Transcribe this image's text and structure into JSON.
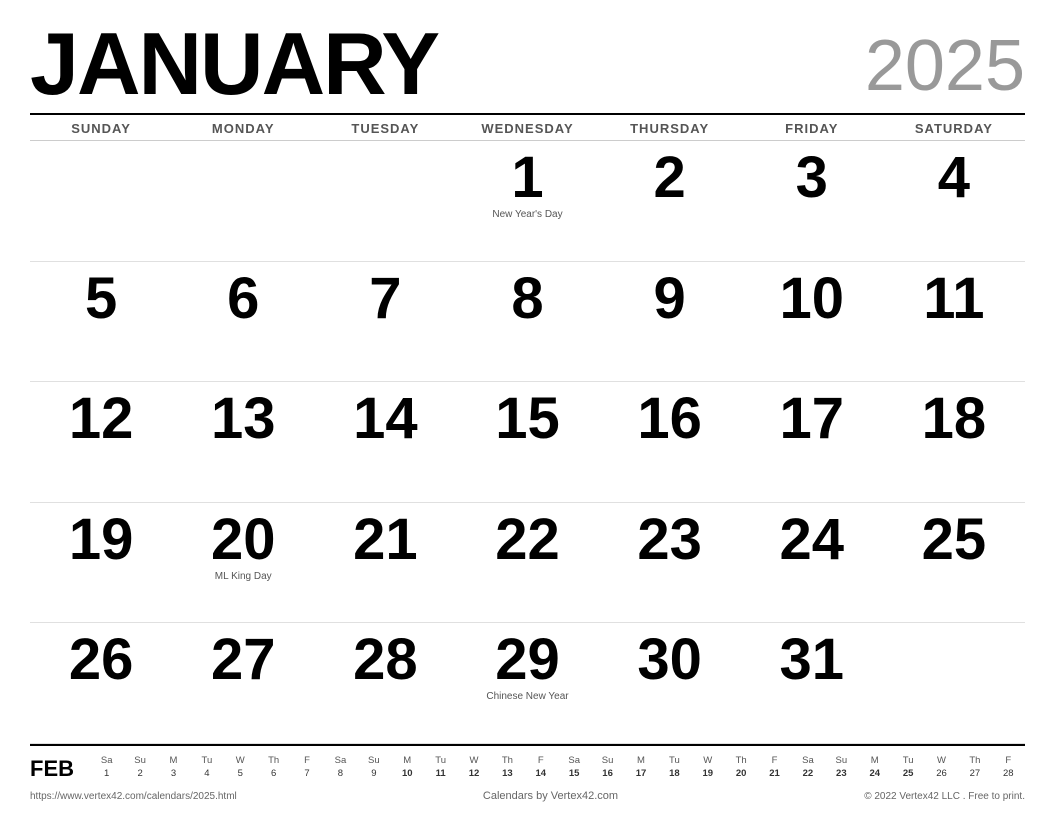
{
  "header": {
    "month": "JANUARY",
    "year": "2025"
  },
  "day_headers": [
    "SUNDAY",
    "MONDAY",
    "TUESDAY",
    "WEDNESDAY",
    "THURSDAY",
    "FRIDAY",
    "SATURDAY"
  ],
  "weeks": [
    {
      "days": [
        {
          "number": "",
          "note": ""
        },
        {
          "number": "",
          "note": ""
        },
        {
          "number": "",
          "note": ""
        },
        {
          "number": "1",
          "note": "New Year's Day"
        },
        {
          "number": "2",
          "note": ""
        },
        {
          "number": "3",
          "note": ""
        },
        {
          "number": "4",
          "note": ""
        }
      ]
    },
    {
      "days": [
        {
          "number": "5",
          "note": ""
        },
        {
          "number": "6",
          "note": ""
        },
        {
          "number": "7",
          "note": ""
        },
        {
          "number": "8",
          "note": ""
        },
        {
          "number": "9",
          "note": ""
        },
        {
          "number": "10",
          "note": ""
        },
        {
          "number": "11",
          "note": ""
        }
      ]
    },
    {
      "days": [
        {
          "number": "12",
          "note": ""
        },
        {
          "number": "13",
          "note": ""
        },
        {
          "number": "14",
          "note": ""
        },
        {
          "number": "15",
          "note": ""
        },
        {
          "number": "16",
          "note": ""
        },
        {
          "number": "17",
          "note": ""
        },
        {
          "number": "18",
          "note": ""
        }
      ]
    },
    {
      "days": [
        {
          "number": "19",
          "note": ""
        },
        {
          "number": "20",
          "note": "ML King Day"
        },
        {
          "number": "21",
          "note": ""
        },
        {
          "number": "22",
          "note": ""
        },
        {
          "number": "23",
          "note": ""
        },
        {
          "number": "24",
          "note": ""
        },
        {
          "number": "25",
          "note": ""
        }
      ]
    },
    {
      "days": [
        {
          "number": "26",
          "note": ""
        },
        {
          "number": "27",
          "note": ""
        },
        {
          "number": "28",
          "note": ""
        },
        {
          "number": "29",
          "note": "Chinese New Year"
        },
        {
          "number": "30",
          "note": ""
        },
        {
          "number": "31",
          "note": ""
        },
        {
          "number": "",
          "note": ""
        }
      ]
    }
  ],
  "mini_calendar": {
    "label": "FEB",
    "headers": [
      "Sa",
      "Su",
      "M",
      "Tu",
      "W",
      "Th",
      "F",
      "Sa",
      "Su",
      "M",
      "Tu",
      "W",
      "Th",
      "F",
      "Sa",
      "Su",
      "M",
      "Tu",
      "W",
      "Th",
      "F",
      "Sa",
      "Su",
      "M",
      "Tu",
      "W",
      "Th",
      "F"
    ],
    "dates": [
      "1",
      "2",
      "3",
      "4",
      "5",
      "6",
      "7",
      "8",
      "9",
      "10",
      "11",
      "12",
      "13",
      "14",
      "15",
      "16",
      "17",
      "18",
      "19",
      "20",
      "21",
      "22",
      "23",
      "24",
      "25",
      "26",
      "27",
      "28"
    ],
    "bold_indices": [
      9,
      10,
      11,
      12,
      13,
      14,
      15,
      16,
      17,
      18,
      19,
      20,
      21,
      22,
      23,
      24
    ]
  },
  "footer": {
    "link": "https://www.vertex42.com/calendars/2025.html",
    "center": "Calendars by Vertex42.com",
    "copyright": "© 2022 Vertex42 LLC . Free to print."
  }
}
